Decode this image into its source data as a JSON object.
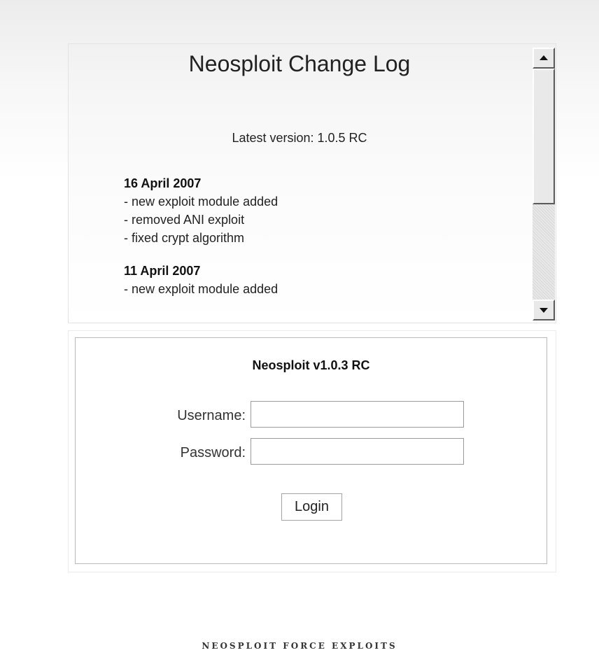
{
  "changelog": {
    "title": "Neosploit Change Log",
    "latest_version": "Latest version: 1.0.5 RC",
    "entries": [
      {
        "date": "16 April 2007",
        "lines": [
          "- new exploit module added",
          "- removed ANI exploit",
          "- fixed crypt algorithm"
        ]
      },
      {
        "date": "11 April 2007",
        "lines": [
          "- new exploit module added"
        ]
      }
    ]
  },
  "scrollbar": {
    "up_icon": "scroll-up-arrow-icon",
    "down_icon": "scroll-down-arrow-icon",
    "thumb_position_fraction": 0,
    "visible_fraction": 0.6
  },
  "login": {
    "title": "Neosploit v1.0.3 RC",
    "username_label": "Username:",
    "username_value": "",
    "password_label": "Password:",
    "password_value": "",
    "button_label": "Login"
  },
  "footer": {
    "text": "NEOSPLOIT FORCE EXPLOITS"
  }
}
